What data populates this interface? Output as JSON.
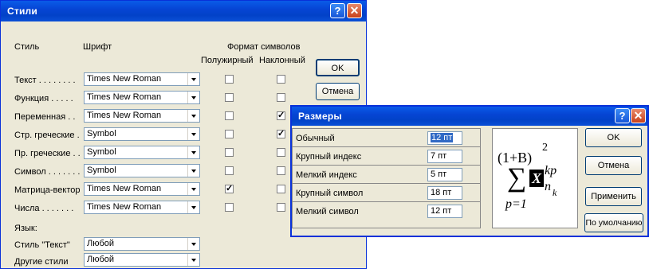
{
  "styles_window": {
    "title": "Стили",
    "header_style": "Стиль",
    "header_font": "Шрифт",
    "header_format": "Формат символов",
    "header_bold": "Полужирный",
    "header_italic": "Наклонный",
    "ok": "OK",
    "cancel": "Отмена",
    "rows": [
      {
        "label": "Текст . . . . . . . .",
        "font": "Times New Roman",
        "bold": "",
        "italic": ""
      },
      {
        "label": "Функция . . . . .",
        "font": "Times New Roman",
        "bold": "",
        "italic": ""
      },
      {
        "label": "Переменная . .",
        "font": "Times New Roman",
        "bold": "",
        "italic": "✓"
      },
      {
        "label": "Стр. греческие .",
        "font": "Symbol",
        "bold": "",
        "italic": "✓"
      },
      {
        "label": "Пр. греческие . .",
        "font": "Symbol",
        "bold": "",
        "italic": ""
      },
      {
        "label": "Символ . . . . . . .",
        "font": "Symbol",
        "bold": "",
        "italic": ""
      },
      {
        "label": "Матрица-вектор",
        "font": "Times New Roman",
        "bold": "✓",
        "italic": ""
      },
      {
        "label": "Числа . . . . . . .",
        "font": "Times New Roman",
        "bold": "",
        "italic": ""
      }
    ],
    "language_label": "Язык:",
    "lang_text_label": "Стиль \"Текст\"",
    "lang_text_value": "Любой",
    "lang_other_label": "Другие стили",
    "lang_other_value": "Любой"
  },
  "sizes_window": {
    "title": "Размеры",
    "rows": [
      {
        "label": "Обычный",
        "value": "12 пт"
      },
      {
        "label": "Крупный индекс",
        "value": "7 пт"
      },
      {
        "label": "Мелкий индекс",
        "value": "5 пт"
      },
      {
        "label": "Крупный символ",
        "value": "18 пт"
      },
      {
        "label": "Мелкий символ",
        "value": "12 пт"
      }
    ],
    "ok": "OK",
    "cancel": "Отмена",
    "apply": "Применить",
    "default": "По умолчанию",
    "preview": {
      "base": "(1+B)",
      "power": "2",
      "sum": "∑",
      "sum_lower": "p=1",
      "placeholder": "X",
      "sup": "kp",
      "sub_n": "n",
      "sub_k": "k"
    }
  },
  "colors": {
    "titlebar": "#0a5be8",
    "face": "#ece9d8",
    "selection": "#316ac5"
  }
}
